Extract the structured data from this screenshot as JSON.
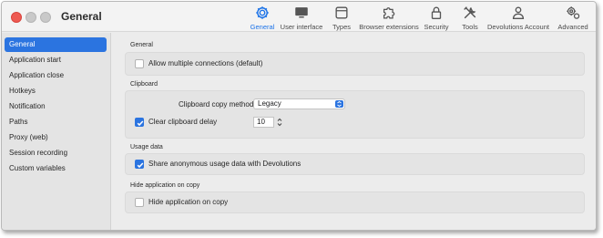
{
  "window": {
    "title": "General"
  },
  "toolbar": {
    "items": [
      {
        "label": "General",
        "icon": "gear-icon",
        "active": true
      },
      {
        "label": "User interface",
        "icon": "monitor-icon",
        "active": false
      },
      {
        "label": "Types",
        "icon": "box-icon",
        "active": false
      },
      {
        "label": "Browser extensions",
        "icon": "puzzle-icon",
        "active": false
      },
      {
        "label": "Security",
        "icon": "lock-icon",
        "active": false
      },
      {
        "label": "Tools",
        "icon": "tools-icon",
        "active": false
      },
      {
        "label": "Devolutions Account",
        "icon": "person-icon",
        "active": false
      },
      {
        "label": "Advanced",
        "icon": "gears-icon",
        "active": false
      }
    ]
  },
  "sidebar": {
    "items": [
      {
        "label": "General",
        "active": true
      },
      {
        "label": "Application start"
      },
      {
        "label": "Application close"
      },
      {
        "label": "Hotkeys"
      },
      {
        "label": "Notification"
      },
      {
        "label": "Paths"
      },
      {
        "label": "Proxy (web)"
      },
      {
        "label": "Session recording"
      },
      {
        "label": "Custom variables"
      }
    ]
  },
  "main": {
    "general": {
      "title": "General",
      "allow_multiple": {
        "label": "Allow multiple connections (default)",
        "checked": false
      }
    },
    "clipboard": {
      "title": "Clipboard",
      "copy_method_label": "Clipboard copy method:",
      "copy_method_value": "Legacy",
      "clear_delay": {
        "label": "Clear clipboard delay",
        "checked": true,
        "value": "10"
      }
    },
    "usage": {
      "title": "Usage data",
      "share": {
        "label": "Share anonymous usage data with Devolutions",
        "checked": true
      }
    },
    "hide": {
      "title": "Hide application on copy",
      "hide_on_copy": {
        "label": "Hide application on copy",
        "checked": false
      }
    }
  },
  "colors": {
    "accent": "#2b74e0",
    "close": "#ee5a52"
  }
}
